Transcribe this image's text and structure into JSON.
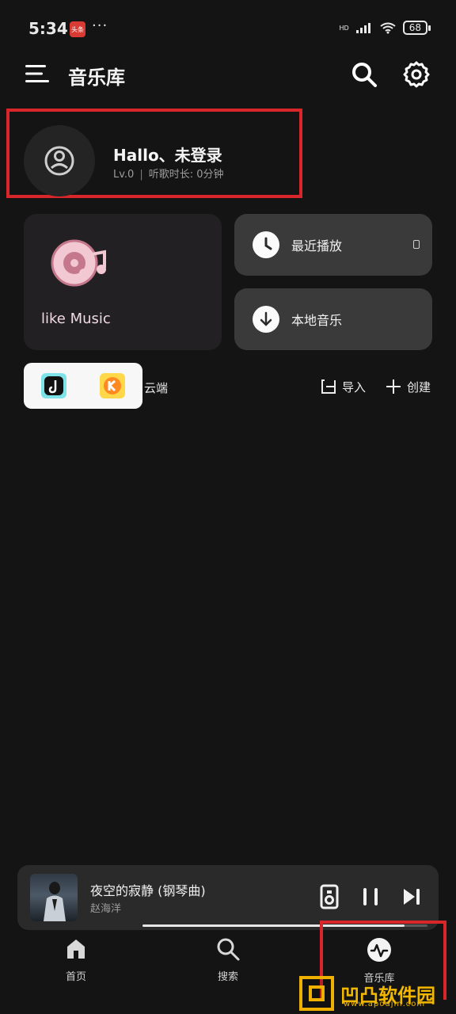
{
  "status_bar": {
    "time": "5:34",
    "app_badge": "头条",
    "more": "···",
    "network": "HD",
    "wifi_sub": "6",
    "battery": "68"
  },
  "header": {
    "title": "音乐库",
    "menu_icon": "menu-icon",
    "search_icon": "search-icon",
    "settings_icon": "gear-icon"
  },
  "user": {
    "greeting": "Hallo、未登录",
    "level": "Lv.0",
    "listen_time": "听歌时长: 0分钟"
  },
  "library": {
    "like_music": "like Music",
    "recent": "最近播放",
    "local": "本地音乐"
  },
  "actions": {
    "cloud_label": "云端",
    "import": "导入",
    "create": "创建"
  },
  "player": {
    "song_title": "夜空的寂静 (钢琴曲)",
    "artist": "赵海洋",
    "progress_fraction": 0.92
  },
  "bottom_nav": {
    "home": "首页",
    "search": "搜索",
    "library": "音乐库"
  },
  "watermark": {
    "text": "凹凸软件园",
    "url": "www.apoujin.com"
  },
  "colors": {
    "background": "#141414",
    "highlight_red": "#d8262b",
    "like_pink": "#f2c8d3",
    "watermark_gold": "#f2b700"
  }
}
